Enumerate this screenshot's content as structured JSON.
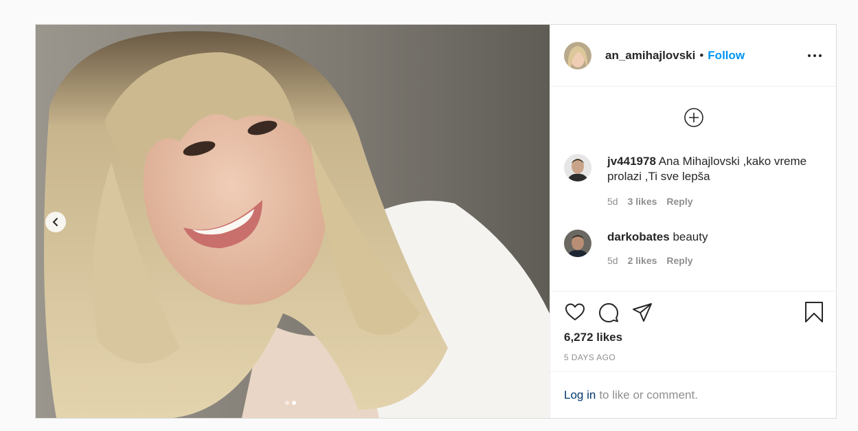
{
  "post": {
    "author": {
      "username": "an_amihajlovski",
      "separator": "•",
      "follow_label": "Follow"
    },
    "media": {
      "slide_index": 2,
      "slide_count": 2
    },
    "comments": [
      {
        "username": "jv441978",
        "text": "Ana Mihajlovski ,kako vreme prolazi ,Ti sve lepša",
        "time": "5d",
        "likes": "3 likes",
        "reply_label": "Reply"
      },
      {
        "username": "darkobates",
        "text": "beauty",
        "time": "5d",
        "likes": "2 likes",
        "reply_label": "Reply"
      }
    ],
    "likes_count": "6,272 likes",
    "posted": "5 DAYS AGO",
    "login_prompt": {
      "link": "Log in",
      "text": "to like or comment."
    }
  },
  "icons": {
    "prev": "chevron-left-icon",
    "more": "more-options-icon",
    "load_more": "plus-circle-icon",
    "like": "heart-icon",
    "comment": "comment-icon",
    "share": "send-icon",
    "save": "bookmark-icon"
  },
  "colors": {
    "follow": "#0095f6",
    "link": "#00376b",
    "muted": "#8e8e8e"
  }
}
